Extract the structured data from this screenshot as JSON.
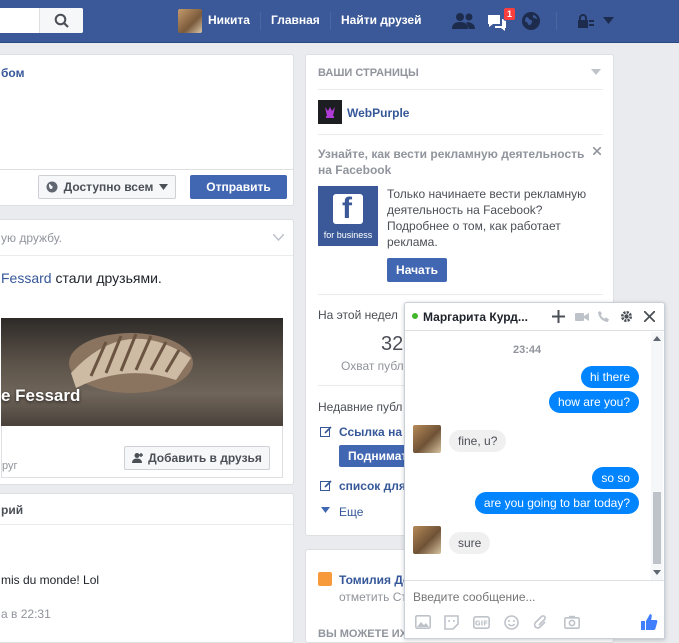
{
  "topbar": {
    "user_name": "Никита",
    "home": "Главная",
    "find_friends": "Найти друзей",
    "notif_count": "1"
  },
  "composer": {
    "header_fragment": "бом",
    "audience_label": "Доступно всем",
    "submit_label": "Отправить"
  },
  "friendship": {
    "header_fragment": "ую дружбу.",
    "text_name": "Fessard",
    "text_rest": " стали друзьями.",
    "photo_name": "e Fessard",
    "sub_fragment": "руг",
    "add_friend_label": "Добавить в друзья"
  },
  "left_bottom": {
    "header_fragment": "рий",
    "text": "mis du monde! Lol",
    "time": "а в 22:31"
  },
  "pages": {
    "header": "ВАШИ СТРАНИЦЫ",
    "page_name": "WebPurple",
    "promo_title": "Узнайте, как вести рекламную деятельность на Facebook",
    "logo_caption": "for business",
    "promo_text": "Только начинаете вести рекламную деятельность на Facebook? Подробнее о том, как работает реклама.",
    "start_label": "Начать",
    "week_label": "На этой недел",
    "week_value": "32",
    "week_caption": "Охват публ",
    "recent_label": "Недавние публ",
    "item1": "Ссылка на",
    "boost_label": "Поднимат",
    "item2": "список для",
    "more_label": "Еще"
  },
  "pages2": {
    "title": "Томилия Де",
    "sub": "отметить Ст",
    "bottom": "ВЫ МОЖЕТЕ ИХ"
  },
  "chat": {
    "name": "Маргарита Курд...",
    "time": "23:44",
    "placeholder": "Введите сообщение...",
    "messages": [
      {
        "text": "hi there"
      },
      {
        "text": "how are you?"
      },
      {
        "text": "fine, u?"
      },
      {
        "text": "so so"
      },
      {
        "text": "are you going to bar today?"
      },
      {
        "text": "sure"
      }
    ]
  },
  "colors": {
    "brand": "#3b5998",
    "button": "#4267b2",
    "outgoing": "#0084ff",
    "online": "#42b72a"
  }
}
